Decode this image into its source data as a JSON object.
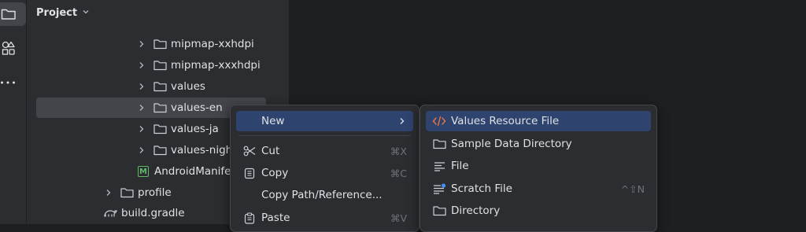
{
  "toolstrip": {
    "items": [
      "folder-icon",
      "shapes-icon",
      "more-icon"
    ]
  },
  "project_panel": {
    "title": "Project",
    "tree": [
      {
        "label": "mipmap-xxhdpi",
        "icon": "folder-icon",
        "expandable": true
      },
      {
        "label": "mipmap-xxxhdpi",
        "icon": "folder-icon",
        "expandable": true
      },
      {
        "label": "values",
        "icon": "folder-icon",
        "expandable": true
      },
      {
        "label": "values-en",
        "icon": "folder-icon",
        "expandable": true,
        "selected": true
      },
      {
        "label": "values-ja",
        "icon": "folder-icon",
        "expandable": true
      },
      {
        "label": "values-nigh",
        "icon": "folder-icon",
        "expandable": true
      },
      {
        "label": "AndroidManife",
        "icon": "manifest-icon",
        "icon_letter": "M",
        "expandable": false
      },
      {
        "label": "profile",
        "icon": "folder-icon",
        "expandable": true
      },
      {
        "label": "build.gradle",
        "icon": "gradle-icon",
        "expandable": false
      }
    ]
  },
  "context_menu": {
    "items": [
      {
        "label": "New",
        "submenu": true,
        "highlighted": true
      },
      {
        "label": "Cut",
        "icon": "scissors-icon",
        "shortcut": "⌘X"
      },
      {
        "label": "Copy",
        "icon": "copy-icon",
        "shortcut": "⌘C"
      },
      {
        "label": "Copy Path/Reference..."
      },
      {
        "label": "Paste",
        "icon": "paste-icon",
        "shortcut": "⌘V"
      }
    ]
  },
  "new_submenu": {
    "items": [
      {
        "label": "Values Resource File",
        "icon": "xml-code-icon",
        "highlighted": true
      },
      {
        "label": "Sample Data Directory",
        "icon": "folder-icon"
      },
      {
        "label": "File",
        "icon": "text-file-icon"
      },
      {
        "label": "Scratch File",
        "icon": "scratch-file-icon",
        "shortcut": "^⇧N"
      },
      {
        "label": "Directory",
        "icon": "folder-icon"
      }
    ]
  },
  "colors": {
    "background": "#1e1f22",
    "panel": "#2b2d30",
    "selection": "#43454a",
    "menu_highlight": "#2e436e",
    "manifest_green": "#5fb865",
    "xml_orange": "#e8754a"
  }
}
